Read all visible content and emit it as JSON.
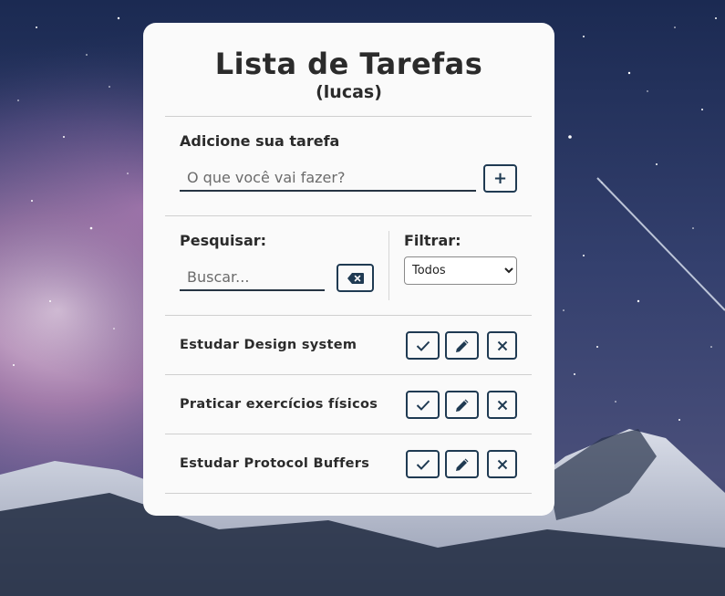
{
  "header": {
    "title": "Lista de Tarefas",
    "user": "(lucas)"
  },
  "add_form": {
    "label": "Adicione sua tarefa",
    "placeholder": "O que você vai fazer?",
    "add_button_label": "+"
  },
  "search": {
    "label": "Pesquisar:",
    "placeholder": "Buscar...",
    "clear_icon": "backspace-icon"
  },
  "filter": {
    "label": "Filtrar:",
    "selected": "Todos"
  },
  "todos": [
    {
      "text": "Estudar Design system"
    },
    {
      "text": "Praticar exercícios físicos"
    },
    {
      "text": "Estudar Protocol Buffers"
    }
  ],
  "todo_actions": {
    "done_icon": "check-icon",
    "edit_icon": "pencil-icon",
    "remove_icon": "x-mark-icon"
  },
  "colors": {
    "card_bg": "#fafafa",
    "accent": "#1f3a52",
    "text": "#2b2b2b",
    "divider": "#cfcfcf"
  }
}
